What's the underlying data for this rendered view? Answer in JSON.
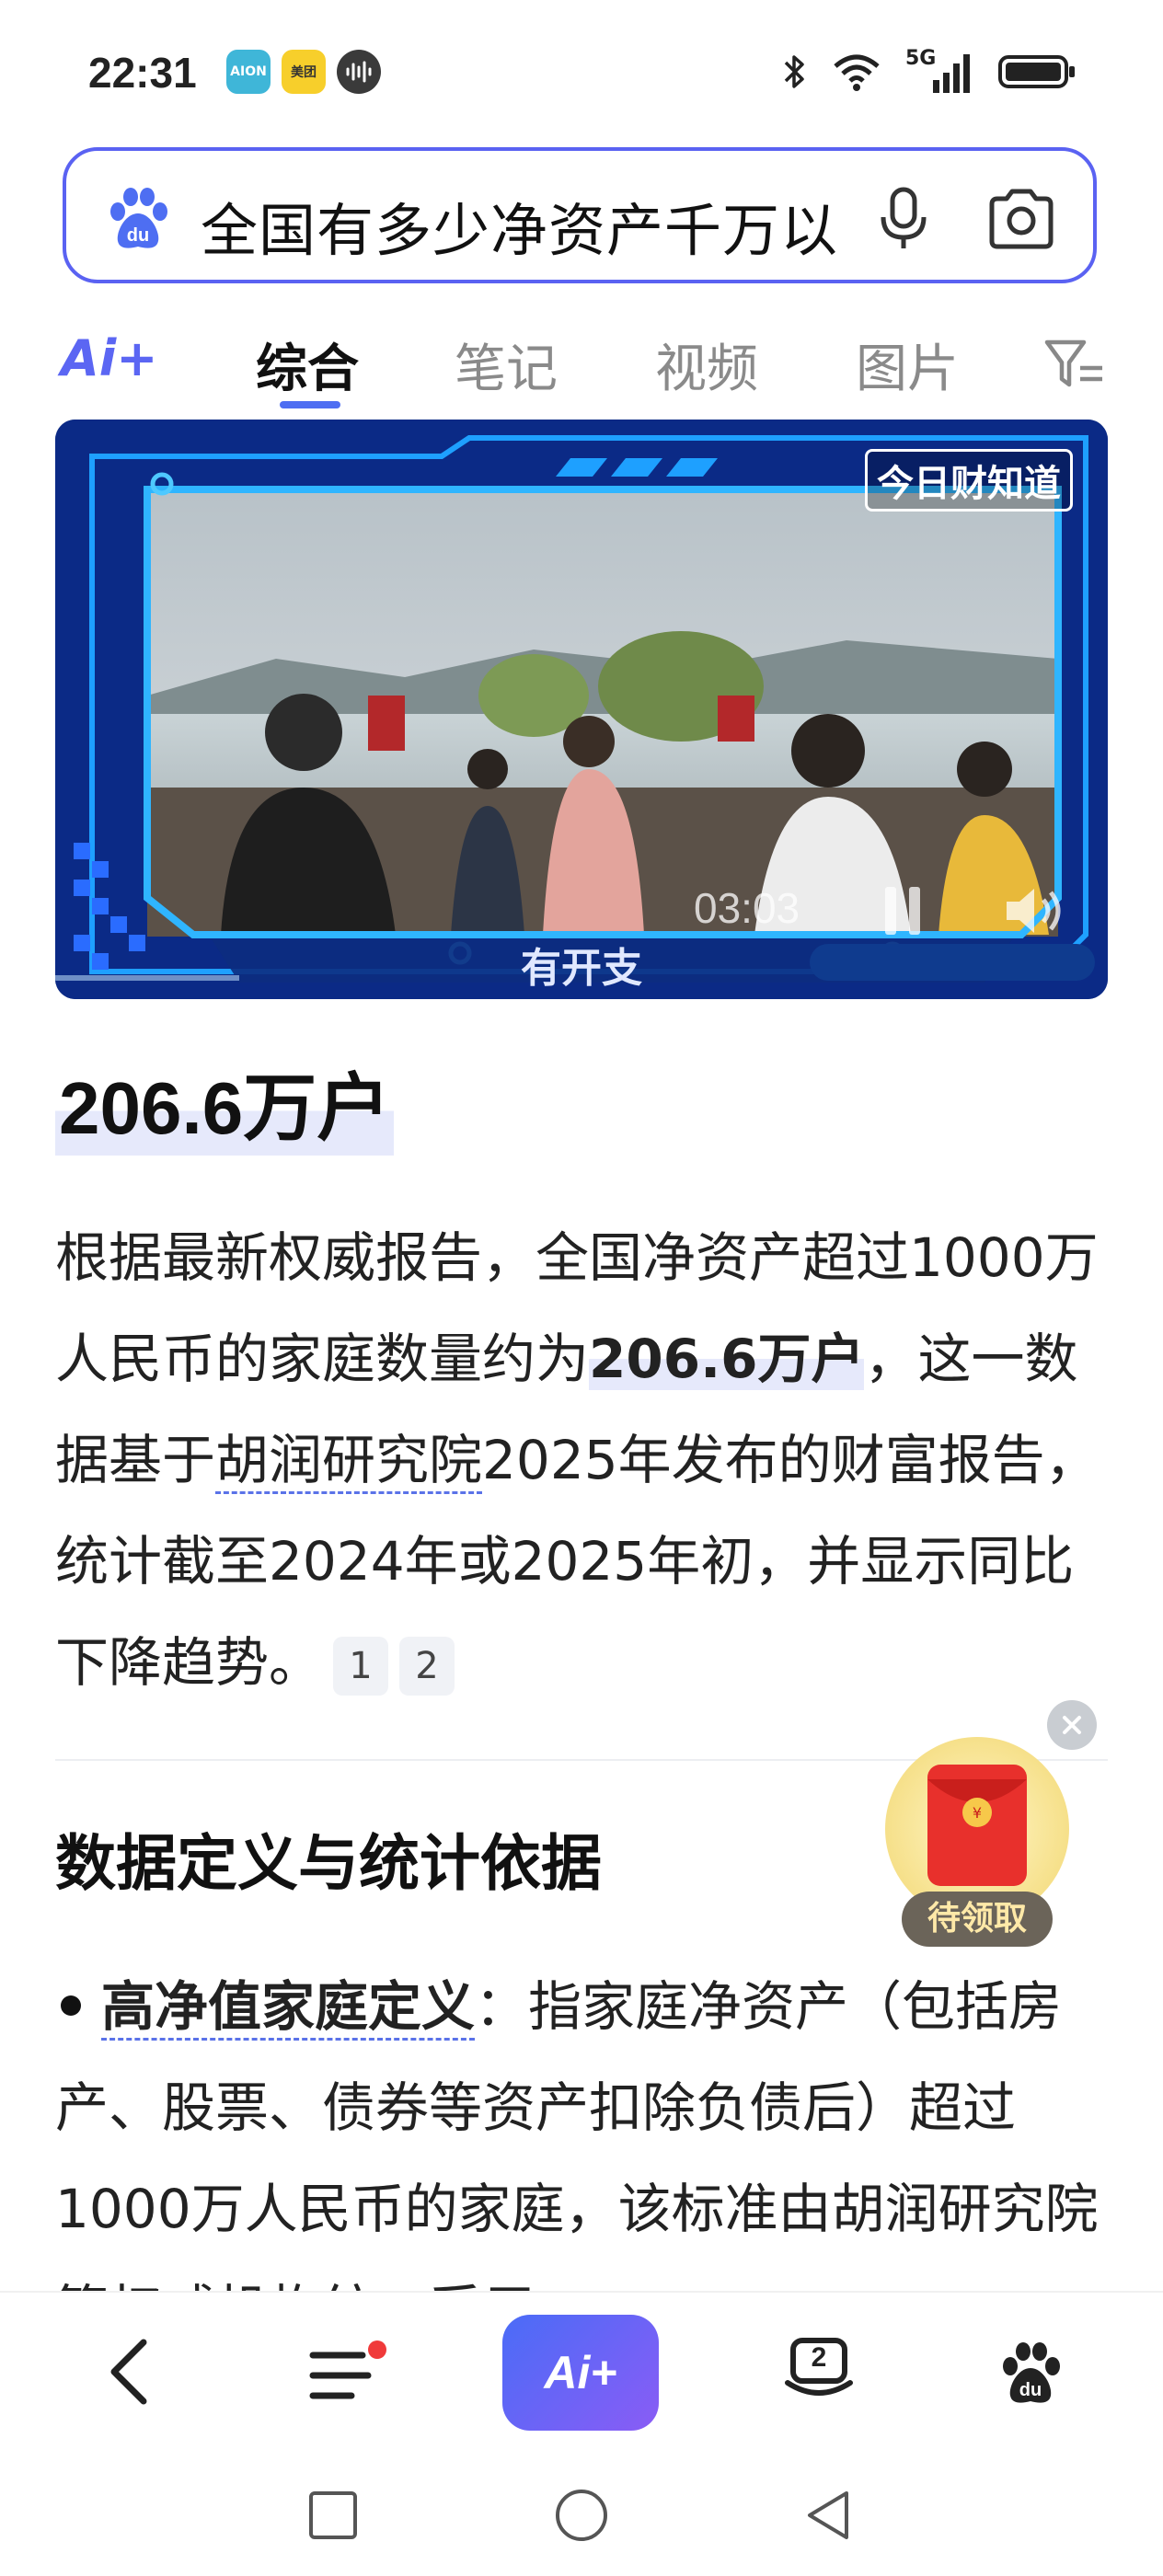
{
  "status_bar": {
    "time": "22:31",
    "app_icons": [
      {
        "name": "aion-app-icon",
        "label": "AION",
        "color": "#3fb6d8"
      },
      {
        "name": "meituan-app-icon",
        "label": "美团",
        "color": "#f7cf2b"
      },
      {
        "name": "audio-app-icon",
        "label": "",
        "color": "#333333"
      }
    ],
    "network": "5G",
    "icons": [
      "bluetooth-icon",
      "wifi-icon",
      "signal-icon",
      "battery-icon"
    ]
  },
  "search": {
    "query": "全国有多少净资产千万以",
    "logo": "baidu-paw-icon",
    "voice_icon": "microphone-icon",
    "camera_icon": "camera-icon"
  },
  "tabs": {
    "ai_label": "Ai+",
    "items": [
      "综合",
      "笔记",
      "视频",
      "图片"
    ],
    "active": "综合",
    "filter_icon": "filter-icon"
  },
  "video": {
    "brand": "今日财知道",
    "caption": "有开支",
    "time": "03:03",
    "pause_icon": "pause-icon",
    "volume_icon": "volume-icon"
  },
  "answer": {
    "headline": "206.6万户",
    "para_1": "根据最新权威报告，全国净资产超过1000万人民币的家庭数量约为",
    "para_hl": "206.6万户",
    "para_2": "，这一数据基于",
    "para_link": "胡润研究院",
    "para_3": "2025年发布的财富报告，统计截至2024年或2025年初，并显示同比下降趋势。",
    "citations": [
      "1",
      "2"
    ]
  },
  "section": {
    "title": "数据定义与统计依据",
    "bullet_term": "高净值家庭定义",
    "bullet_text": "：指家庭净资产（包括房产、股票、债券等资产扣除负债后）超过1000万人民币的家庭，该标准由胡润研究院等权威机构统一采用。"
  },
  "red_packet": {
    "label": "待领取",
    "close_icon": "close-icon"
  },
  "bottom_nav": {
    "back_icon": "back-arrow-icon",
    "menu_icon": "menu-icon",
    "ai_label": "Ai+",
    "tabs_count": "2",
    "home_icon": "baidu-paw-icon"
  },
  "system_nav": [
    "square-icon",
    "circle-icon",
    "triangle-back-icon"
  ],
  "colors": {
    "accent": "#4e6ef2",
    "search_border": "#5a62f2",
    "ai_gradient_start": "#4a6cf7",
    "ai_gradient_end": "#8a5cf5",
    "red_dot": "#f03a3a"
  }
}
